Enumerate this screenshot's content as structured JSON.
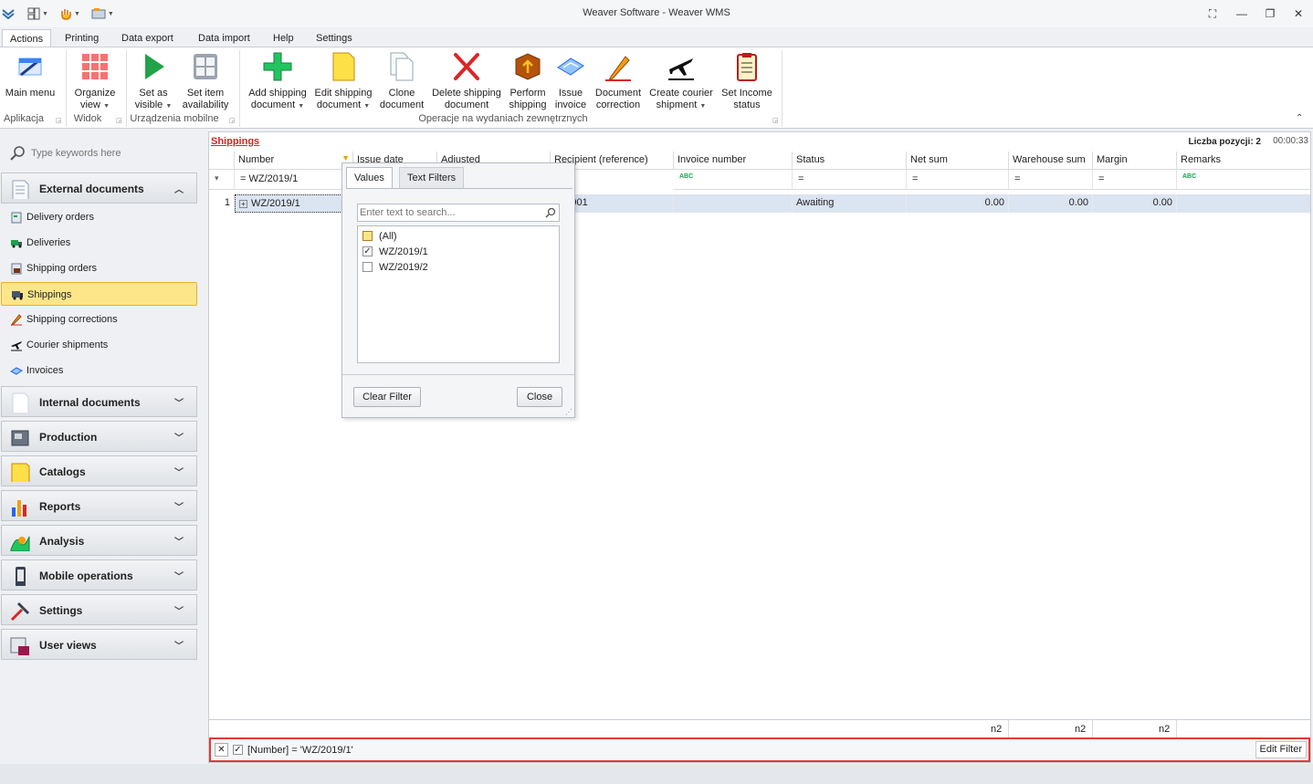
{
  "window": {
    "title": "Weaver Software - Weaver WMS"
  },
  "ribbon": {
    "tabs": [
      "Actions",
      "Printing",
      "Data export",
      "Data import",
      "Help",
      "Settings"
    ],
    "buttons": {
      "main_menu": "Main menu",
      "organize_view_1": "Organize",
      "organize_view_2": "view",
      "set_visible_1": "Set as",
      "set_visible_2": "visible",
      "set_avail_1": "Set item",
      "set_avail_2": "availability",
      "add_ship_1": "Add shipping",
      "add_ship_2": "document",
      "edit_ship_1": "Edit shipping",
      "edit_ship_2": "document",
      "clone_1": "Clone",
      "clone_2": "document",
      "delete_1": "Delete shipping",
      "delete_2": "document",
      "perform_1": "Perform",
      "perform_2": "shipping",
      "issue_1": "Issue",
      "issue_2": "invoice",
      "correction_1": "Document",
      "correction_2": "correction",
      "courier_1": "Create courier",
      "courier_2": "shipment",
      "income_1": "Set Income",
      "income_2": "status"
    },
    "groups": {
      "aplikacja": "Aplikacja",
      "widok": "Widok",
      "mobile": "Urządzenia mobilne",
      "ops": "Operacje na wydaniach zewnętrznych"
    }
  },
  "nav": {
    "search_placeholder": "Type keywords here",
    "external": "External documents",
    "items": [
      "Delivery orders",
      "Deliveries",
      "Shipping orders",
      "Shippings",
      "Shipping corrections",
      "Courier shipments",
      "Invoices"
    ],
    "sections": [
      "Internal documents",
      "Production",
      "Catalogs",
      "Reports",
      "Analysis",
      "Mobile operations",
      "Settings",
      "User views"
    ]
  },
  "grid": {
    "title": "Shippings",
    "count_label": "Liczba pozycji: 2",
    "timer": "00:00:33",
    "columns": [
      "Number",
      "Issue date",
      "Adjusted",
      "Recipient (reference)",
      "Invoice number",
      "Status",
      "Net sum",
      "Warehouse sum",
      "Margin",
      "Remarks"
    ],
    "filter_number": "WZ/2019/1",
    "eq": "=",
    "abc": "ABC",
    "row": {
      "index": "1",
      "number": "WZ/2019/1",
      "recipient": "000001",
      "status": "Awaiting",
      "net": "0.00",
      "warehouse": "0.00",
      "margin": "0.00"
    },
    "sums": [
      "n2",
      "n2",
      "n2"
    ],
    "filter_expr": "[Number] = 'WZ/2019/1'",
    "edit_filter": "Edit Filter"
  },
  "popup": {
    "tab_values": "Values",
    "tab_text": "Text Filters",
    "search_placeholder": "Enter text to search...",
    "options": [
      "(All)",
      "WZ/2019/1",
      "WZ/2019/2"
    ],
    "clear": "Clear Filter",
    "close": "Close"
  },
  "colors": {
    "accent": "#e53935",
    "selection": "#fde68a"
  }
}
